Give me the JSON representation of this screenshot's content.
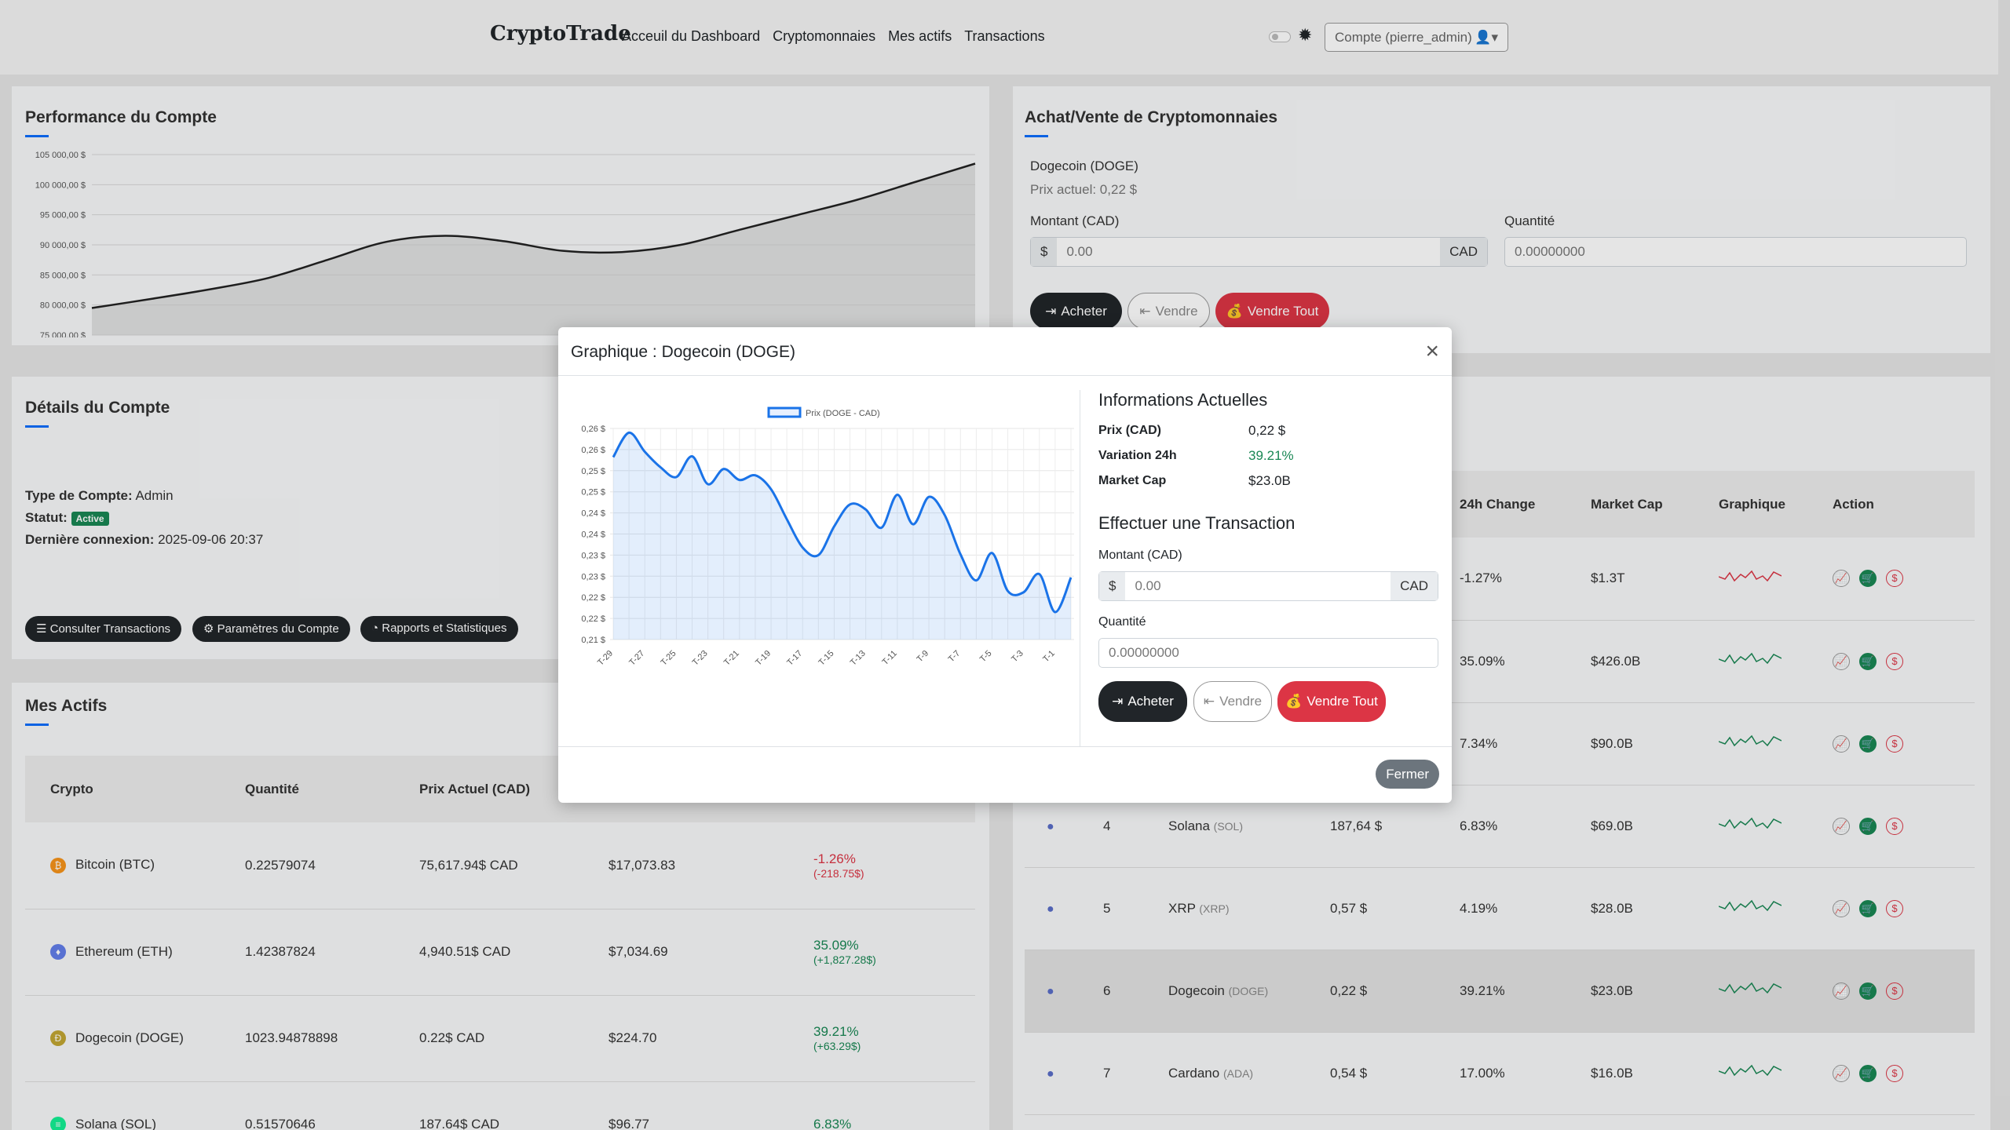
{
  "nav": {
    "brand": "CryptoTrade",
    "links": [
      "Acceuil du Dashboard",
      "Cryptomonnaies",
      "Mes actifs",
      "Transactions"
    ],
    "account": "Compte (pierre_admin)"
  },
  "performance": {
    "title": "Performance du Compte",
    "chart_data": {
      "type": "area",
      "y_ticks": [
        "105 000,00 $",
        "100 000,00 $",
        "95 000,00 $",
        "90 000,00 $",
        "85 000,00 $",
        "80 000,00 $",
        "75 000,00 $"
      ],
      "ylim": [
        75000,
        105000
      ],
      "values": [
        79500,
        81000,
        82600,
        84500,
        87500,
        90500,
        91500,
        90600,
        89000,
        88800,
        90000,
        92500,
        95000,
        97500,
        100500,
        103500
      ]
    }
  },
  "account_details": {
    "title": "Détails du Compte",
    "type_label": "Type de Compte:",
    "type_value": "Admin",
    "status_label": "Statut:",
    "status_value": "Active",
    "last_login_label": "Dernière connexion:",
    "last_login_value": "2025-09-06 20:37",
    "buttons": [
      "Consulter Transactions",
      "Paramètres du Compte",
      "Rapports et Statistiques"
    ]
  },
  "assets": {
    "title": "Mes Actifs",
    "headers": [
      "Crypto",
      "Quantité",
      "Prix Actuel (CAD)"
    ],
    "rows": [
      {
        "name": "Bitcoin (BTC)",
        "qty": "0.22579074",
        "price": "75,617.94$ CAD",
        "value": "$17,073.83",
        "change": "-1.26%",
        "delta": "(-218.75$)",
        "dir": "neg",
        "color": "#f7931a",
        "sym": "₿"
      },
      {
        "name": "Ethereum (ETH)",
        "qty": "1.42387824",
        "price": "4,940.51$ CAD",
        "value": "$7,034.69",
        "change": "35.09%",
        "delta": "(+1,827.28$)",
        "dir": "pos",
        "color": "#627eea",
        "sym": "♦"
      },
      {
        "name": "Dogecoin (DOGE)",
        "qty": "1023.94878898",
        "price": "0.22$ CAD",
        "value": "$224.70",
        "change": "39.21%",
        "delta": "(+63.29$)",
        "dir": "pos",
        "color": "#c2a633",
        "sym": "Ð"
      },
      {
        "name": "Solana (SOL)",
        "qty": "0.51570646",
        "price": "187.64$ CAD",
        "value": "$96.77",
        "change": "6.83%",
        "delta": "",
        "dir": "pos",
        "color": "#14f195",
        "sym": "≡"
      }
    ]
  },
  "trade": {
    "title": "Achat/Vente de Cryptomonnaies",
    "coin": "Dogecoin (DOGE)",
    "price": "Prix actuel: 0,22 $",
    "amount_label": "Montant (CAD)",
    "qty_label": "Quantité",
    "currency_symbol": "$",
    "currency": "CAD",
    "amount_placeholder": "0.00",
    "qty_placeholder": "0.00000000",
    "buy": "Acheter",
    "sell": "Vendre",
    "sell_all": "Vendre Tout"
  },
  "market": {
    "headers": [
      "24h Change",
      "Market Cap",
      "Graphique",
      "Action"
    ],
    "rows": [
      {
        "rank": "",
        "name": "",
        "symbol": "",
        "price": "",
        "change": "-1.27%",
        "dir": "neg",
        "cap": "$1.3T",
        "spark": "#dc3545"
      },
      {
        "rank": "",
        "name": "",
        "symbol": "",
        "price": "",
        "change": "35.09%",
        "dir": "pos",
        "cap": "$426.0B",
        "spark": "#198754"
      },
      {
        "rank": "",
        "name": "",
        "symbol": "",
        "price": "",
        "change": "7.34%",
        "dir": "pos",
        "cap": "$90.0B",
        "spark": "#198754"
      },
      {
        "rank": "4",
        "name": "Solana",
        "symbol": "(SOL)",
        "price": "187,64 $",
        "change": "6.83%",
        "dir": "pos",
        "cap": "$69.0B",
        "spark": "#198754"
      },
      {
        "rank": "5",
        "name": "XRP",
        "symbol": "(XRP)",
        "price": "0,57 $",
        "change": "4.19%",
        "dir": "pos",
        "cap": "$28.0B",
        "spark": "#198754"
      },
      {
        "rank": "6",
        "name": "Dogecoin",
        "symbol": "(DOGE)",
        "price": "0,22 $",
        "change": "39.21%",
        "dir": "pos",
        "cap": "$23.0B",
        "spark": "#198754"
      },
      {
        "rank": "7",
        "name": "Cardano",
        "symbol": "(ADA)",
        "price": "0,54 $",
        "change": "17.00%",
        "dir": "pos",
        "cap": "$16.0B",
        "spark": "#198754"
      }
    ]
  },
  "modal": {
    "title": "Graphique : Dogecoin (DOGE)",
    "chart_data": {
      "type": "line",
      "legend": "Prix (DOGE - CAD)",
      "x": [
        "T-29",
        "T-28",
        "T-27",
        "T-26",
        "T-25",
        "T-24",
        "T-23",
        "T-22",
        "T-21",
        "T-20",
        "T-19",
        "T-18",
        "T-17",
        "T-16",
        "T-15",
        "T-14",
        "T-13",
        "T-12",
        "T-11",
        "T-10",
        "T-9",
        "T-8",
        "T-7",
        "T-6",
        "T-5",
        "T-4",
        "T-3",
        "T-2",
        "T-1",
        "T-0"
      ],
      "x_tick_labels": [
        "T-29",
        "T-27",
        "T-25",
        "T-23",
        "T-21",
        "T-19",
        "T-17",
        "T-15",
        "T-13",
        "T-11",
        "T-9",
        "T-7",
        "T-5",
        "T-3",
        "T-1"
      ],
      "y_tick_labels": [
        "0,26 $",
        "0,26 $",
        "0,25 $",
        "0,25 $",
        "0,24 $",
        "0,24 $",
        "0,23 $",
        "0,23 $",
        "0,22 $",
        "0,22 $",
        "0,21 $"
      ],
      "ylim": [
        0.21,
        0.26
      ],
      "values": [
        0.2532,
        0.259,
        0.2545,
        0.2508,
        0.2485,
        0.2534,
        0.2468,
        0.2504,
        0.2478,
        0.2489,
        0.2456,
        0.2385,
        0.2318,
        0.23,
        0.2368,
        0.242,
        0.2408,
        0.2365,
        0.2443,
        0.2373,
        0.2438,
        0.2395,
        0.2302,
        0.224,
        0.2305,
        0.2215,
        0.2212,
        0.2255,
        0.2165,
        0.2247
      ]
    },
    "info_title": "Informations Actuelles",
    "price_label": "Prix (CAD)",
    "price_value": "0,22 $",
    "variation_label": "Variation 24h",
    "variation_value": "39.21%",
    "cap_label": "Market Cap",
    "cap_value": "$23.0B",
    "tx_title": "Effectuer une Transaction",
    "amount_label": "Montant (CAD)",
    "amount_placeholder": "0.00",
    "currency_symbol": "$",
    "currency": "CAD",
    "qty_label": "Quantité",
    "qty_placeholder": "0.00000000",
    "buy": "Acheter",
    "sell": "Vendre",
    "sell_all": "Vendre Tout",
    "close": "Fermer"
  }
}
